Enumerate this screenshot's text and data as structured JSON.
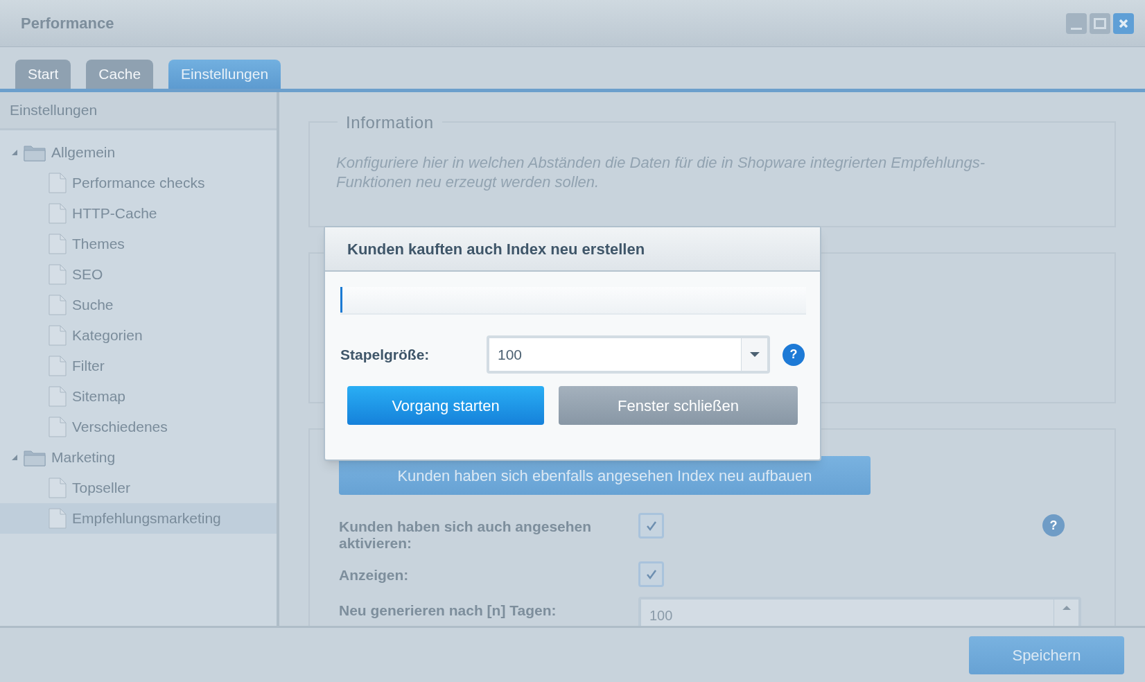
{
  "window": {
    "title": "Performance"
  },
  "tabs": [
    {
      "label": "Start",
      "selected": false
    },
    {
      "label": "Cache",
      "selected": false
    },
    {
      "label": "Einstellungen",
      "selected": true
    }
  ],
  "sidebar": {
    "header": "Einstellungen",
    "tree": [
      {
        "label": "Allgemein",
        "kind": "folder",
        "expanded": true,
        "selected": false,
        "children": [
          {
            "label": "Performance checks",
            "kind": "page",
            "selected": false
          },
          {
            "label": "HTTP-Cache",
            "kind": "page",
            "selected": false
          },
          {
            "label": "Themes",
            "kind": "page",
            "selected": false
          },
          {
            "label": "SEO",
            "kind": "page",
            "selected": false
          },
          {
            "label": "Suche",
            "kind": "page",
            "selected": false
          },
          {
            "label": "Kategorien",
            "kind": "page",
            "selected": false
          },
          {
            "label": "Filter",
            "kind": "page",
            "selected": false
          },
          {
            "label": "Sitemap",
            "kind": "page",
            "selected": false
          },
          {
            "label": "Verschiedenes",
            "kind": "page",
            "selected": false
          }
        ]
      },
      {
        "label": "Marketing",
        "kind": "folder",
        "expanded": true,
        "selected": false,
        "children": [
          {
            "label": "Topseller",
            "kind": "page",
            "selected": false
          },
          {
            "label": "Empfehlungsmarketing",
            "kind": "page",
            "selected": true
          }
        ]
      }
    ]
  },
  "information": {
    "legend": "Information",
    "text": "Konfiguriere hier in welchen Abständen die Daten für die in Shopware integrierten Empfehlungs-Funktionen neu erzeugt werden sollen."
  },
  "form": {
    "rebuild_button": "Kunden haben sich ebenfalls angesehen Index neu aufbauen",
    "rows": [
      {
        "kind": "checkbox",
        "label": "Kunden haben sich auch angesehen aktivieren:",
        "checked": true,
        "help": "?"
      },
      {
        "kind": "checkbox",
        "label": "Anzeigen:",
        "checked": true
      },
      {
        "kind": "number",
        "label": "Neu generieren nach [n] Tagen:",
        "value": "100"
      }
    ]
  },
  "dialog": {
    "title": "Kunden kauften auch Index neu erstellen",
    "progress": {
      "level": 0.004
    },
    "batch_label": "Stapelgröße:",
    "batch_value": "100",
    "help": "?",
    "buttons": [
      {
        "label": "Vorgang starten",
        "kind": "primary"
      },
      {
        "label": "Fenster schließen",
        "kind": "secondary"
      }
    ]
  },
  "save_button": "Speichern"
}
